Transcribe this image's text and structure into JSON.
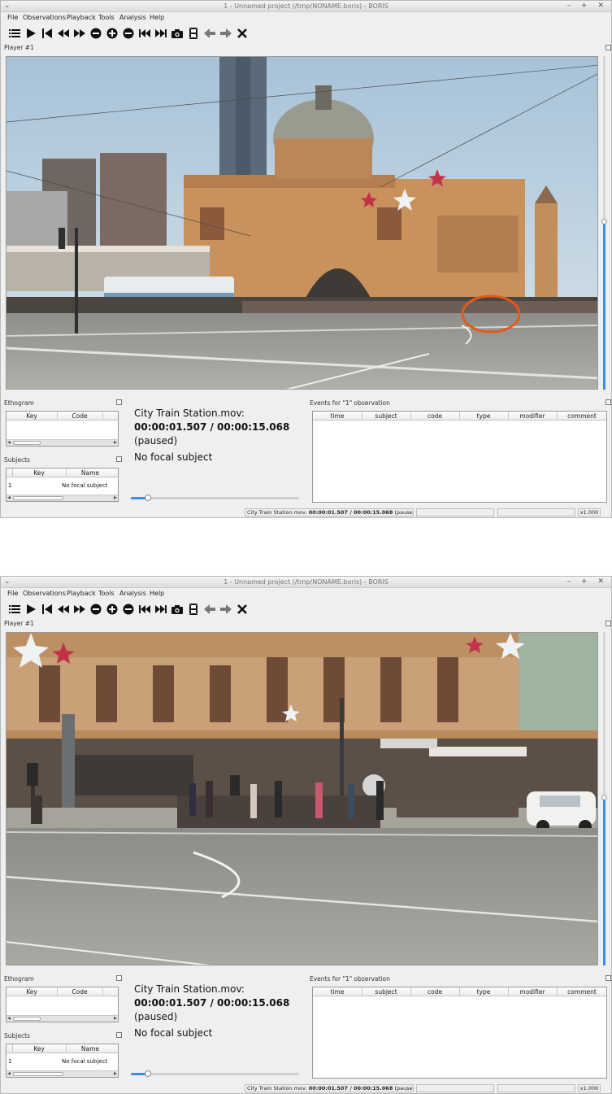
{
  "window": {
    "title": "1 - Unnamed project (/tmp/NONAME.boris) - BORIS",
    "menu_glyph": "⌄",
    "controls": "– + ✕"
  },
  "menu": [
    "File",
    "Observations",
    "Playback",
    "Tools",
    "Analysis",
    "Help"
  ],
  "toolbar": [
    "list-icon",
    "play-icon",
    "skip-to-start-icon",
    "rewind-icon",
    "fast-forward-icon",
    "speed-down-icon",
    "speed-up-icon",
    "speed-reset-icon",
    "previous-media-icon",
    "next-media-icon",
    "snapshot-icon",
    "frame-by-frame-icon",
    "arrow-back-icon",
    "arrow-forward-icon",
    "close-icon"
  ],
  "player": {
    "label": "Player #1",
    "volume": 0.5
  },
  "ethogram": {
    "label": "Ethogram",
    "columns": [
      "Key",
      "Code"
    ]
  },
  "subjects": {
    "label": "Subjects",
    "columns": [
      "Key",
      "Name"
    ],
    "rows": [
      {
        "index": "1",
        "key": "",
        "name": "No focal subject"
      }
    ]
  },
  "media_info": {
    "file": "City Train Station.mov:",
    "time": "00:00:01.507 / 00:00:15.068",
    "state": "(paused)",
    "focal": "No focal subject",
    "progress": 0.1
  },
  "events": {
    "label": "Events for \"1\" observation",
    "columns": [
      "time",
      "subject",
      "code",
      "type",
      "modifier",
      "comment"
    ]
  },
  "status": {
    "file": "City Train Station.mov: ",
    "time": "00:00:01.507 / 00:00:15.068",
    "state": " (paused)",
    "speed": "x1.000"
  },
  "colors": {
    "accent": "#3d8fd8",
    "annotation": "#e25a1c",
    "window_bg": "#efefef"
  }
}
